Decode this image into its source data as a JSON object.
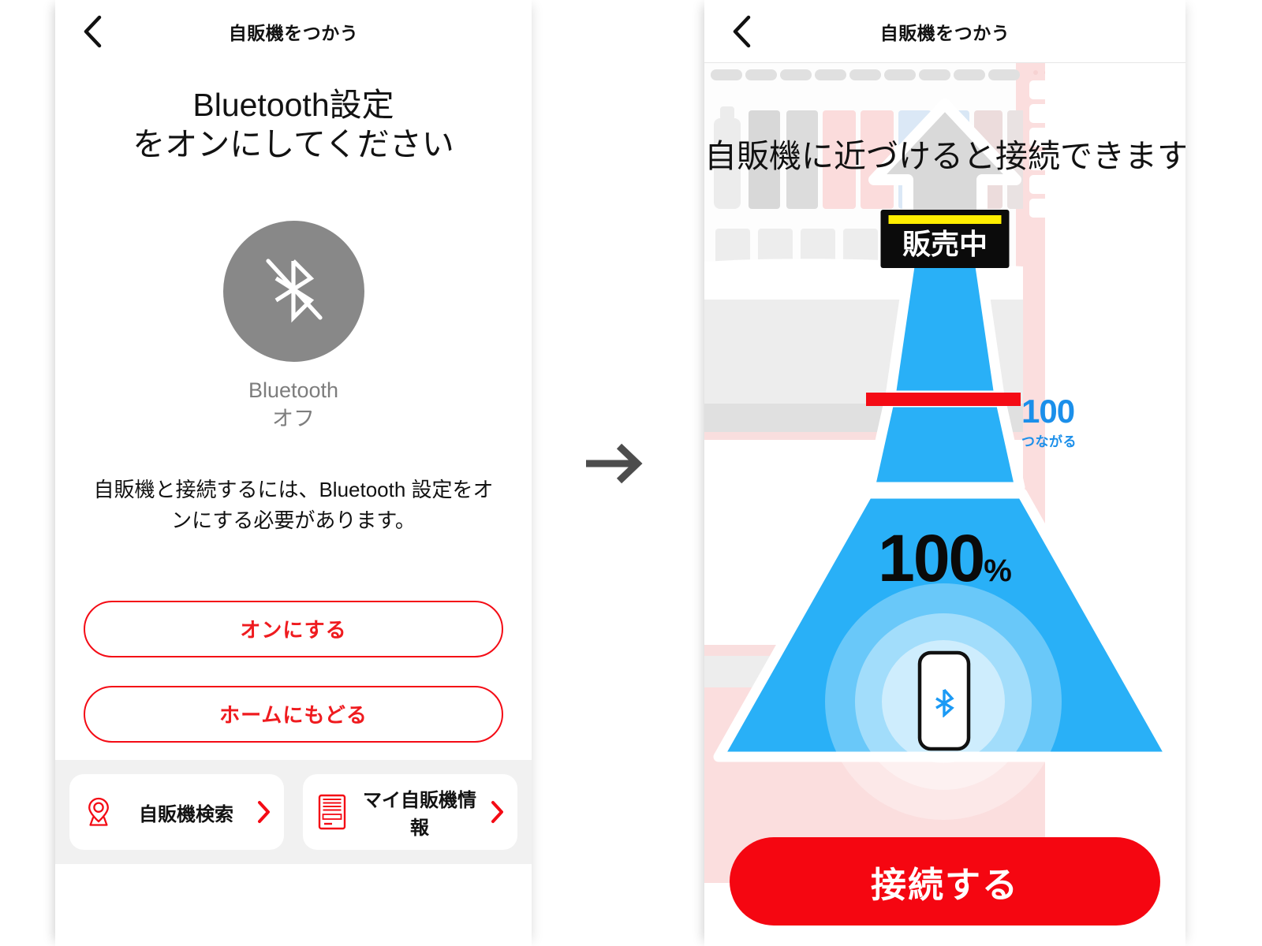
{
  "left_screen": {
    "navbar": {
      "title": "自販機をつかう",
      "back_icon": "chevron-left-icon"
    },
    "heading_line1": "Bluetooth設定",
    "heading_line2": "をオンにしてください",
    "bluetooth_status": {
      "icon": "bluetooth-off-icon",
      "label": "Bluetooth",
      "state": "オフ",
      "circle_color": "#888888"
    },
    "description_line1": "自販機と接続するには、Bluetooth 設定をオ",
    "description_line2": "ンにする必要があります。",
    "buttons": [
      {
        "label": "オンにする",
        "name": "turn-on-button",
        "color": "#ef1b1f"
      },
      {
        "label": "ホームにもどる",
        "name": "back-to-home-button",
        "color": "#ef1b1f"
      }
    ],
    "bottom_bar": [
      {
        "label": "自販機検索",
        "icon": "map-pin-icon",
        "chevron": "chevron-right-icon"
      },
      {
        "label": "マイ自販機情報",
        "icon": "vending-machine-icon",
        "chevron": "chevron-right-icon"
      }
    ]
  },
  "flow_arrow": {
    "icon": "arrow-right-icon",
    "color": "#4d4d4d"
  },
  "right_screen": {
    "navbar": {
      "title": "自販機をつかう",
      "back_icon": "chevron-left-icon"
    },
    "heading": "自販機に近づけると接続できます",
    "sale_sign": {
      "text": "販売中",
      "bar_color": "#ffee00",
      "bg_color": "#0b0b0b"
    },
    "signal_marker": {
      "value": "100",
      "caption": "つながる",
      "color": "#1b8fea",
      "line_color": "#f40b15"
    },
    "signal_percent": {
      "value": "100",
      "unit": "%"
    },
    "device": {
      "icon": "bluetooth-icon",
      "device_icon": "smartphone-icon",
      "color": "#1b9af5"
    },
    "connect_button": {
      "label": "接続する",
      "color": "#f50611"
    },
    "colors": {
      "beam": "#29b0f7",
      "arrow_top": "#d9d9d9",
      "bg_pink": "#fbdede"
    }
  }
}
